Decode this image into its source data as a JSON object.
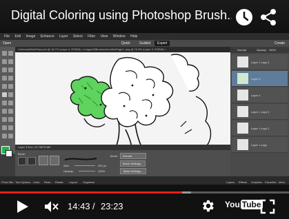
{
  "video": {
    "title": "Digital Coloring using Photoshop Brush...",
    "time_current": "14:43",
    "time_separator": "/",
    "time_total": "23:23",
    "progress_played": 0.63,
    "progress_buffered": 0.66
  },
  "colors": {
    "progress_played": "#e62117",
    "foreground_swatch": "#22b14c"
  },
  "logo": {
    "you": "You",
    "tube": "Tube"
  },
  "icons": {
    "clock": "watch-later-icon",
    "share": "share-icon",
    "play": "play-icon",
    "volume": "volume-muted-icon",
    "settings": "gear-icon",
    "fullscreen": "fullscreen-icon"
  },
  "editor": {
    "menu": [
      "File",
      "Edit",
      "Image",
      "Enhance",
      "Layer",
      "Select",
      "Filter",
      "View",
      "Window",
      "Help"
    ],
    "open_label": "Open",
    "create_label": "Create",
    "modes": [
      "Quick",
      "Guided",
      "Expert"
    ],
    "tab_text": "CartoonyBirdsPlots.psd @ 16.7% (Layer 4, RGB/8) ×   ImagesOfBrushesDoodlesPage2 .png @ 75.8% (Layer 3, RGB/8) ×",
    "status_text": "Layer 3   Doc: 13.7M/75.6M",
    "options": {
      "brush_label": "Brush",
      "mode_label": "Mode:",
      "mode_value": "Normal",
      "size_label": "Size:",
      "size_value": "300 px",
      "opacity_label": "Opacity:",
      "opacity_value": "100%",
      "brush_settings": "Brush Settings...",
      "tablet_settings": "Tablet Settings..."
    },
    "taskbar": [
      "Photo Bin",
      "Tool Options",
      "Undo",
      "Redo",
      "Rotate",
      "Layout",
      "Organizer",
      "Layers",
      "Effects",
      "Graphics",
      "Favorites",
      "More"
    ],
    "layers": {
      "blend_mode": "Normal",
      "opacity_label": "Opacity:",
      "opacity_value": "100%",
      "rows": [
        "Layer 1 copy 2",
        "Layer 3",
        "Layer 4",
        "Layer 1 copy 3",
        "Layer 1 copy 2",
        "Layer 1 copy"
      ]
    }
  }
}
